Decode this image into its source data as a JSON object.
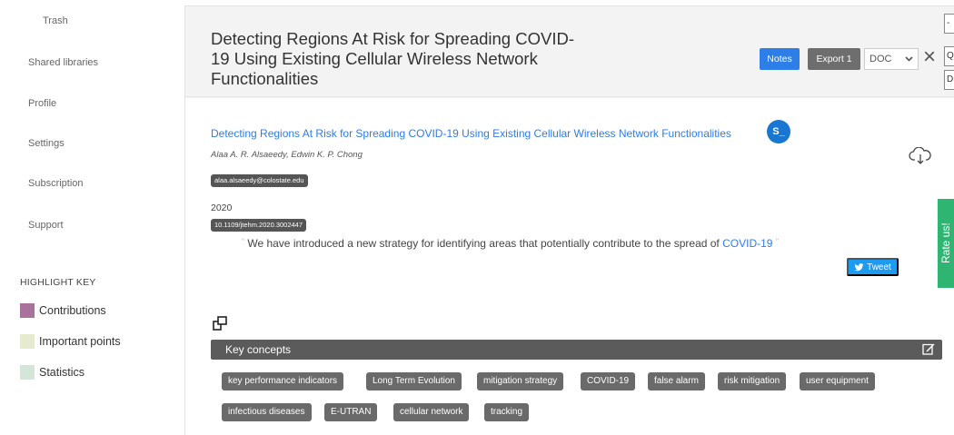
{
  "sidebar": {
    "items": [
      {
        "label": "Trash"
      },
      {
        "label": "Shared libraries"
      },
      {
        "label": "Profile"
      },
      {
        "label": "Settings"
      },
      {
        "label": "Subscription"
      },
      {
        "label": "Support"
      }
    ],
    "highlight_key": {
      "title": "HIGHLIGHT KEY",
      "items": [
        {
          "label": "Contributions",
          "color": "#a8729c"
        },
        {
          "label": "Important points",
          "color": "#e6ebcf"
        },
        {
          "label": "Statistics",
          "color": "#d3e6d8"
        }
      ]
    }
  },
  "header": {
    "title": "Detecting Regions At Risk for Spreading COVID-19 Using Existing Cellular Wireless Network Functionalities",
    "notes_label": "Notes",
    "export_label": "Export 1",
    "format_value": "DOC",
    "edge_glyphs": [
      "-",
      "Q",
      "D"
    ]
  },
  "paper": {
    "link_text": "Detecting Regions At Risk for Spreading COVID-19 Using Existing Cellular Wireless Network Functionalities",
    "badge": "S_",
    "authors": "Alaa A. R. Alsaeedy, Edwin K. P. Chong",
    "email": "alaa.alsaeedy@colostate.edu",
    "year": "2020",
    "doi": "10.1109/jtehm.2020.3002447"
  },
  "quote": {
    "text": "We have introduced a new strategy for identifying areas that potentially contribute to the spread of ",
    "link": "COVID-19",
    "open_mark": "“",
    "close_mark": "”",
    "tweet_label": "Tweet"
  },
  "key_concepts": {
    "title": "Key concepts",
    "chips": [
      "key performance indicators",
      "Long Term Evolution",
      "mitigation strategy",
      "COVID-19",
      "false alarm",
      "risk mitigation",
      "user equipment",
      "infectious diseases",
      "E-UTRAN",
      "cellular network",
      "tracking"
    ]
  },
  "rate_tab": "Rate us!",
  "colors": {
    "accent": "#2d7ee6",
    "rate_green": "#2db571",
    "badge_blue": "#1976d2"
  }
}
